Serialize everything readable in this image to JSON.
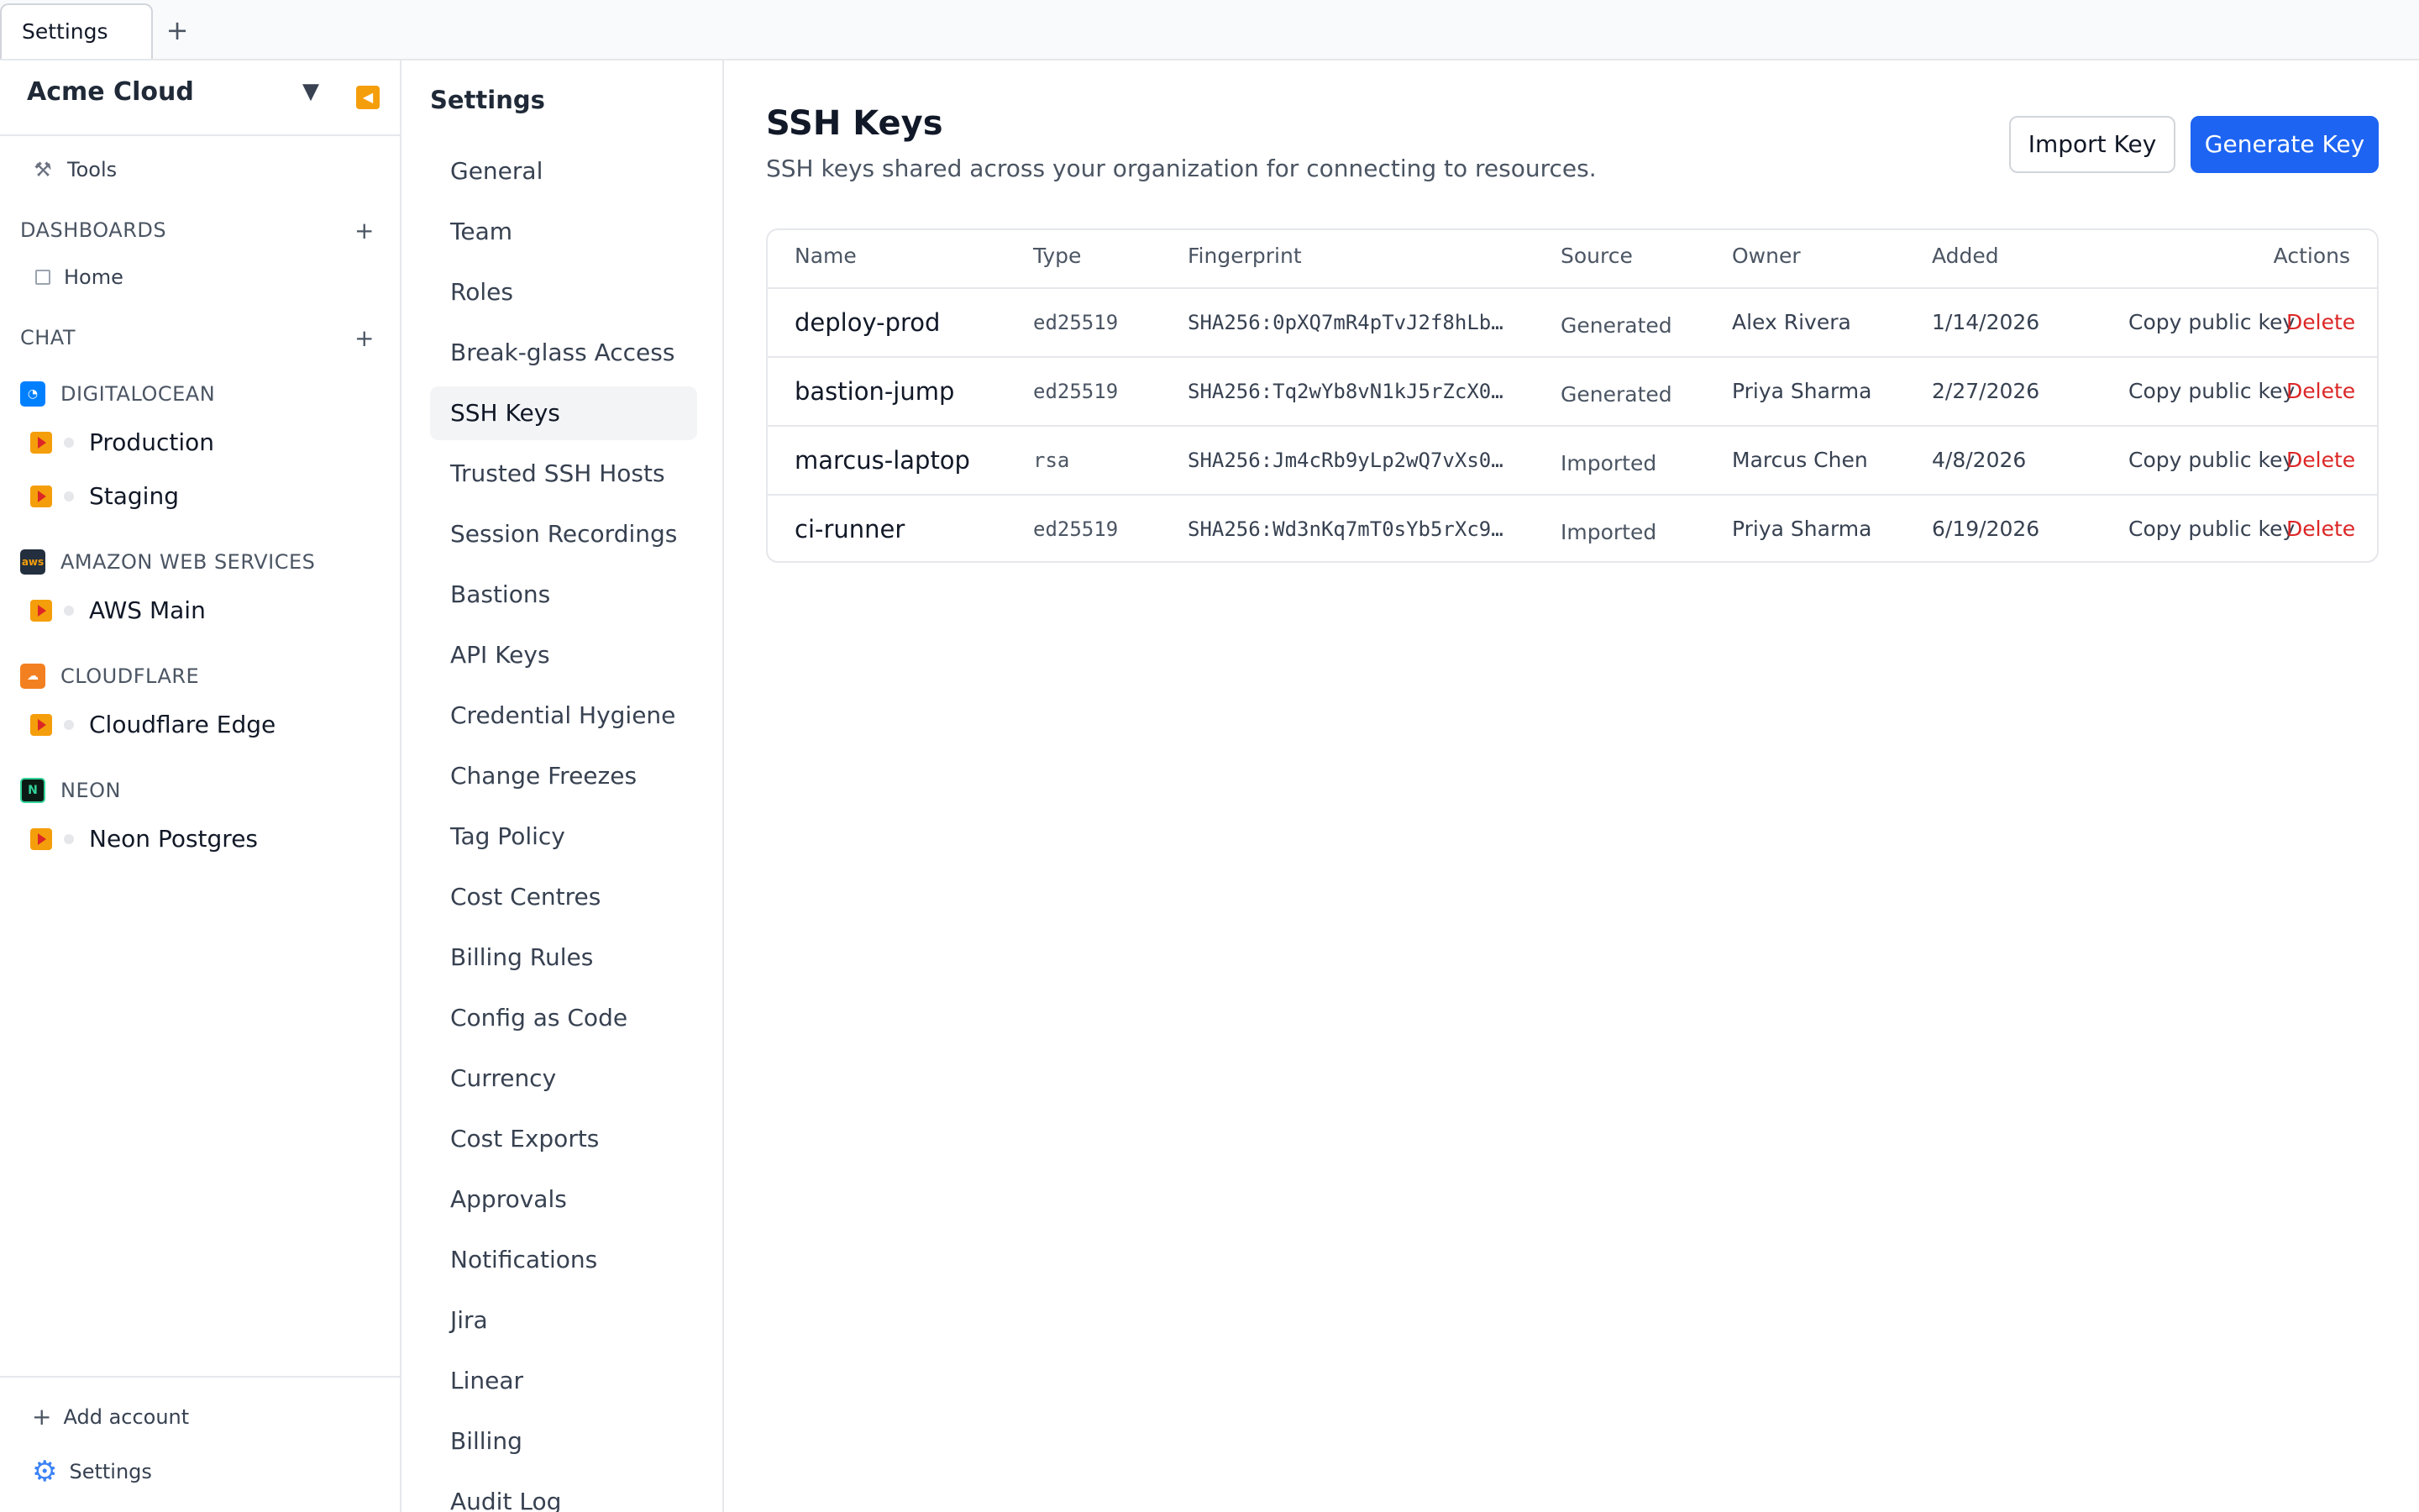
{
  "tabs": [
    {
      "label": "Settings"
    }
  ],
  "tab_add": "+",
  "account": {
    "name": "Acme Cloud"
  },
  "left_nav": {
    "tools_label": "Tools",
    "dashboards_header": "DASHBOARDS",
    "home_label": "Home",
    "chat_header": "CHAT",
    "providers": [
      {
        "name": "DIGITALOCEAN",
        "color": "#0080ff",
        "resources": [
          "Production",
          "Staging"
        ]
      },
      {
        "name": "AMAZON WEB SERVICES",
        "color": "#232f3e",
        "logo_text": "aws",
        "resources": [
          "AWS Main"
        ]
      },
      {
        "name": "CLOUDFLARE",
        "color": "#f38020",
        "resources": [
          "Cloudflare Edge"
        ]
      },
      {
        "name": "NEON",
        "color": "#0b1a14",
        "resources": [
          "Neon Postgres"
        ]
      }
    ],
    "add_account": "Add account",
    "settings": "Settings"
  },
  "settings_nav": {
    "title": "Settings",
    "items": [
      "General",
      "Team",
      "Roles",
      "Break-glass Access",
      "SSH Keys",
      "Trusted SSH Hosts",
      "Session Recordings",
      "Bastions",
      "API Keys",
      "Credential Hygiene",
      "Change Freezes",
      "Tag Policy",
      "Cost Centres",
      "Billing Rules",
      "Config as Code",
      "Currency",
      "Cost Exports",
      "Approvals",
      "Notifications",
      "Jira",
      "Linear",
      "Billing",
      "Audit Log"
    ],
    "active": "SSH Keys"
  },
  "page": {
    "title": "SSH Keys",
    "subtitle": "SSH keys shared across your organization for connecting to resources.",
    "import_button": "Import Key",
    "generate_button": "Generate Key"
  },
  "table": {
    "columns": [
      "Name",
      "Type",
      "Fingerprint",
      "Source",
      "Owner",
      "Added",
      "Actions"
    ],
    "rows": [
      {
        "name": "deploy-prod",
        "type": "ed25519",
        "fingerprint": "SHA256:0pXQ7mR4pTvJ2f8hLb…",
        "source": "Generated",
        "owner": "Alex Rivera",
        "added": "1/14/2026",
        "copy": "Copy public key",
        "delete": "Delete"
      },
      {
        "name": "bastion-jump",
        "type": "ed25519",
        "fingerprint": "SHA256:Tq2wYb8vN1kJ5rZcX0…",
        "source": "Generated",
        "owner": "Priya Sharma",
        "added": "2/27/2026",
        "copy": "Copy public key",
        "delete": "Delete"
      },
      {
        "name": "marcus-laptop",
        "type": "rsa",
        "fingerprint": "SHA256:Jm4cRb9yLp2wQ7vXs0…",
        "source": "Imported",
        "owner": "Marcus Chen",
        "added": "4/8/2026",
        "copy": "Copy public key",
        "delete": "Delete"
      },
      {
        "name": "ci-runner",
        "type": "ed25519",
        "fingerprint": "SHA256:Wd3nKq7mT0sYb5rXc9…",
        "source": "Imported",
        "owner": "Priya Sharma",
        "added": "6/19/2026",
        "copy": "Copy public key",
        "delete": "Delete"
      }
    ]
  }
}
